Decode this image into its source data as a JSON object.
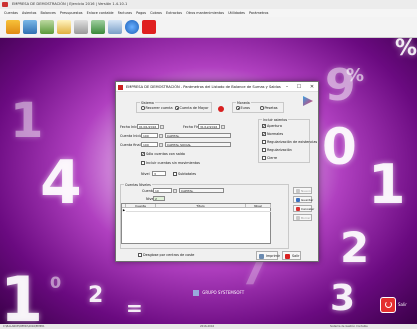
{
  "app": {
    "title": "EMPRESA DE DEMOSTRACIÓN | Ejercicio 2016 | Versión 1.4.10.1",
    "menu": [
      "Cuentas",
      "Asientos",
      "Balances",
      "Presupuestos",
      "Enlace contable",
      "Facturas",
      "Pagos",
      "Cobros",
      "Extractos",
      "Otros mantenimientos",
      "Utilidades",
      "Parámetros"
    ]
  },
  "toolbar": {
    "icons": [
      "chart-icon",
      "calculator-icon",
      "grid-icon",
      "document-icon",
      "folder-icon",
      "tag-icon",
      "globe-icon",
      "help-icon",
      "power-icon"
    ]
  },
  "dialog": {
    "title": "EMPRESA DE DEMOSTRACIÓN - Parámetros del Listado de Balance de Sumas y Saldos",
    "sistema": {
      "legend": "Sistema",
      "opt_recorrer": "Recorrer cuenta",
      "opt_mayor": "Cuenta de Mayor"
    },
    "moneda": {
      "legend": "Moneda",
      "opt_euros": "Euros",
      "opt_pesetas": "Pesetas"
    },
    "fecha_inicio_label": "Fecha Inicio",
    "fecha_inicio": "01/01/2016",
    "fecha_fin_label": "Fecha Fin",
    "fecha_fin": "31/12/2016",
    "cuenta_inicial_label": "Cuenta Inicial",
    "cuenta_inicial": "100",
    "cuenta_inicial_desc": "CAPITAL",
    "cuenta_final_label": "Cuenta final",
    "cuenta_final": "100",
    "cuenta_final_desc": "CAPITAL SOCIAL",
    "solo_con_saldo": "Sólo cuentas con saldo",
    "incluir_sin_mov": "Incluir cuentas sin movimientos",
    "nivel_label": "Nivel",
    "nivel_value": "3",
    "subtotales": "Subtotales",
    "incluir_asientos": {
      "legend": "Incluir asientos",
      "items": [
        "Apertura",
        "Normales",
        "Regularización de existencias",
        "Regularización",
        "Cierre"
      ],
      "checked": [
        true,
        true,
        false,
        false,
        false
      ]
    },
    "cuentas_nivel": {
      "legend": "Cuentas Niveles",
      "cuenta_label": "Cuenta",
      "cuenta_value": "10",
      "cuenta_desc": "CAPITAL",
      "nivel_label": "Nivel",
      "nivel_value": "2"
    },
    "side_buttons": [
      "Nuevo",
      "Guardar",
      "Cancelar",
      "Borrar"
    ],
    "grid_headers": [
      "Cuenta",
      "Título",
      "Nivel"
    ],
    "desglose": "Desglose por centros de coste",
    "imprimir": "Imprimir",
    "salir": "Salir"
  },
  "desktop": {
    "brand_line1": "GRUPO SYSTEMSOFT",
    "salir_label": "Salir"
  },
  "statusbar": {
    "left": "C:\\BALANCE\\DEMO\\2016\\EMP01",
    "center": "2016-2016",
    "right": "Sistema de Gestión Contable"
  }
}
